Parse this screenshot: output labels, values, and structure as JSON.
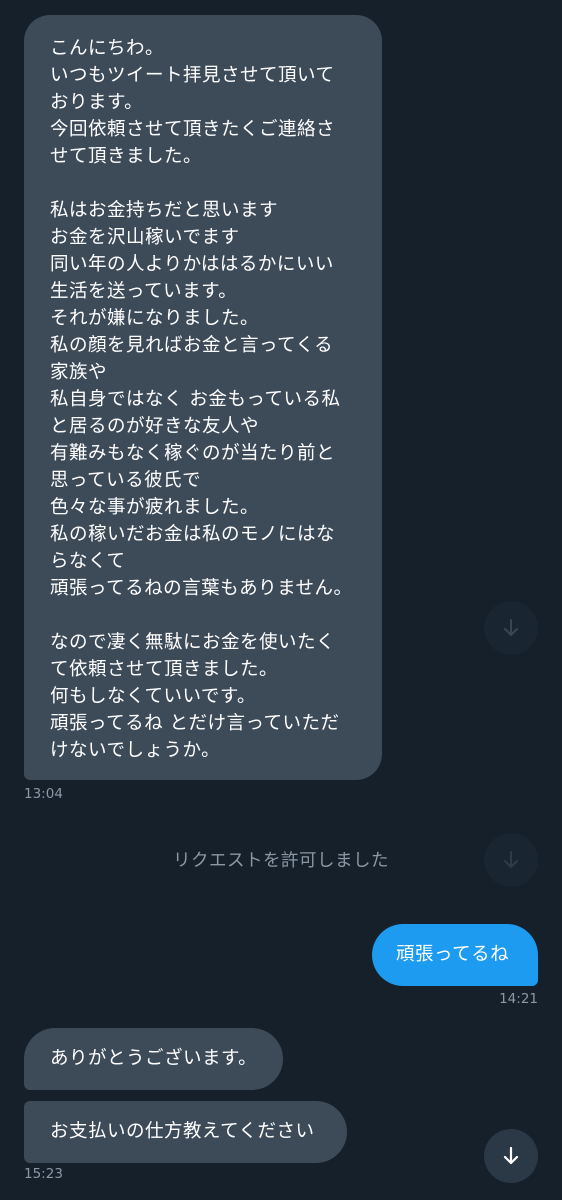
{
  "conversation": {
    "first_message": {
      "lines": [
        "こんにちわ。",
        "いつもツイート拝見させて頂いて",
        "おります。",
        "今回依頼させて頂きたくご連絡さ",
        "せて頂きました。",
        "",
        "私はお金持ちだと思います",
        "お金を沢山稼いでます",
        "同い年の人よりかははるかにいい",
        "生活を送っています。",
        "それが嫌になりました。",
        "私の顔を見ればお金と言ってくる",
        "家族や",
        "私自身ではなく お金もっている私",
        "と居るのが好きな友人や",
        "有難みもなく稼ぐのが当たり前と",
        "思っている彼氏で",
        "色々な事が疲れました。",
        "私の稼いだお金は私のモノにはな",
        "らなくて",
        "頑張ってるねの言葉もありません。",
        "",
        "なので凄く無駄にお金を使いたく",
        "て依頼させて頂きました。",
        "何もしなくていいです。",
        "頑張ってるね とだけ言っていただ",
        "けないでしょうか。"
      ],
      "time": "13:04"
    },
    "system_note": "リクエストを許可しました",
    "sent_message": {
      "text": "頑張ってるね",
      "time": "14:21"
    },
    "reply_messages": [
      {
        "text": "ありがとうございます。"
      },
      {
        "text": "お支払いの仕方教えてください"
      }
    ],
    "reply_time": "15:23"
  },
  "icons": {
    "scroll_down": "arrow-down-icon"
  },
  "colors": {
    "background": "#15202b",
    "received_bubble": "#3d4b59",
    "sent_bubble": "#1d9bf0",
    "muted_text": "#8b98a5"
  }
}
